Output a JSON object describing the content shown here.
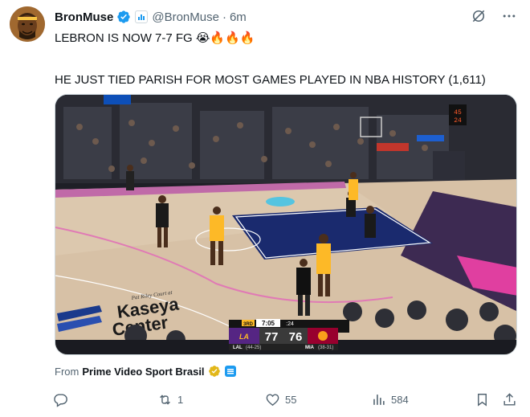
{
  "author": {
    "display_name": "BronMuse",
    "handle": "@BronMuse",
    "separator": "·",
    "time": "6m"
  },
  "tweet": {
    "line1": "LEBRON IS NOW 7-7 FG 😭🔥🔥🔥",
    "line2": "HE JUST TIED PARISH FOR MOST GAMES PLAYED IN NBA HISTORY (1,611)"
  },
  "video": {
    "arena_sign_small": "Pat Riley Court at",
    "arena_sign_big1": "Kaseya",
    "arena_sign_big2": "Center",
    "shot_clock": "24",
    "scorebug": {
      "quarter": "3RD",
      "clock": "7:05",
      "shot": ":24",
      "home_team": "LAL",
      "home_record": "(44-25)",
      "home_score": "77",
      "away_team": "MIA",
      "away_record": "(38-31)",
      "away_score": "76"
    }
  },
  "attribution": {
    "prefix": "From",
    "source": "Prime Video Sport Brasil"
  },
  "actions": {
    "replies": "",
    "reposts": "1",
    "likes": "55",
    "views": "584"
  },
  "icons": {
    "verified": "verified-badge-icon",
    "affiliate": "affiliate-badge-icon",
    "grok": "grok-icon",
    "more": "more-icon",
    "reply": "reply-icon",
    "repost": "repost-icon",
    "like": "heart-icon",
    "views": "views-icon",
    "bookmark": "bookmark-icon",
    "share": "share-icon"
  },
  "colors": {
    "verified_blue": "#1d9bf0",
    "text_primary": "#0f1419",
    "text_secondary": "#536471",
    "court_wood": "#d7c1a6",
    "court_paint": "#1a2a6e",
    "lakers_gold": "#fdb927",
    "heat_red": "#98002e"
  }
}
